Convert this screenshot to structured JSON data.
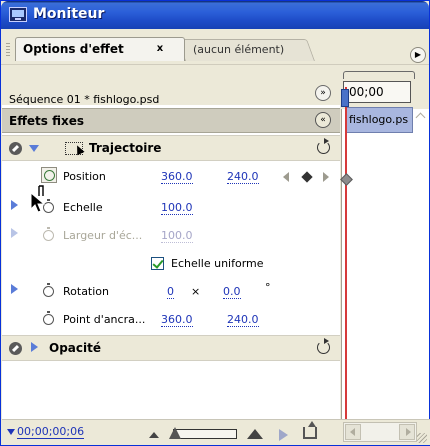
{
  "window": {
    "title": "Moniteur"
  },
  "tabs": [
    {
      "label": "Options d'effet",
      "close": "x",
      "active": true
    },
    {
      "label": "(aucun élément)",
      "active": false
    }
  ],
  "sequence": {
    "label": "Séquence 01 * fishlogo.psd",
    "button": "»"
  },
  "section": {
    "title": "Effets fixes",
    "collapse": "«"
  },
  "effects": {
    "trajectoire": {
      "label": "Trajectoire",
      "position": {
        "label": "Position",
        "x": "360.0",
        "y": "240.0"
      },
      "echelle": {
        "label": "Echelle",
        "value": "100.0"
      },
      "largeur": {
        "label": "Largeur d'éc...",
        "value": "100.0"
      },
      "uniform": {
        "label": "Echelle uniforme",
        "checked": true
      },
      "rotation": {
        "label": "Rotation",
        "turns": "0",
        "times": "×",
        "degrees": "0.0",
        "degree_sign": "°"
      },
      "ancrage": {
        "label": "Point d'ancra...",
        "x": "360.0",
        "y": "240.0"
      }
    },
    "opacite": {
      "label": "Opacité"
    }
  },
  "timeline": {
    "timecode": "00;00",
    "clip_label": "fishlogo.ps"
  },
  "footer": {
    "timecode": "00;00;00;06"
  },
  "colors": {
    "title_bar": "#2b5fd9",
    "value_blue": "#1f35b8",
    "clip": "#a8b6df",
    "playhead": "#d63a3a"
  }
}
